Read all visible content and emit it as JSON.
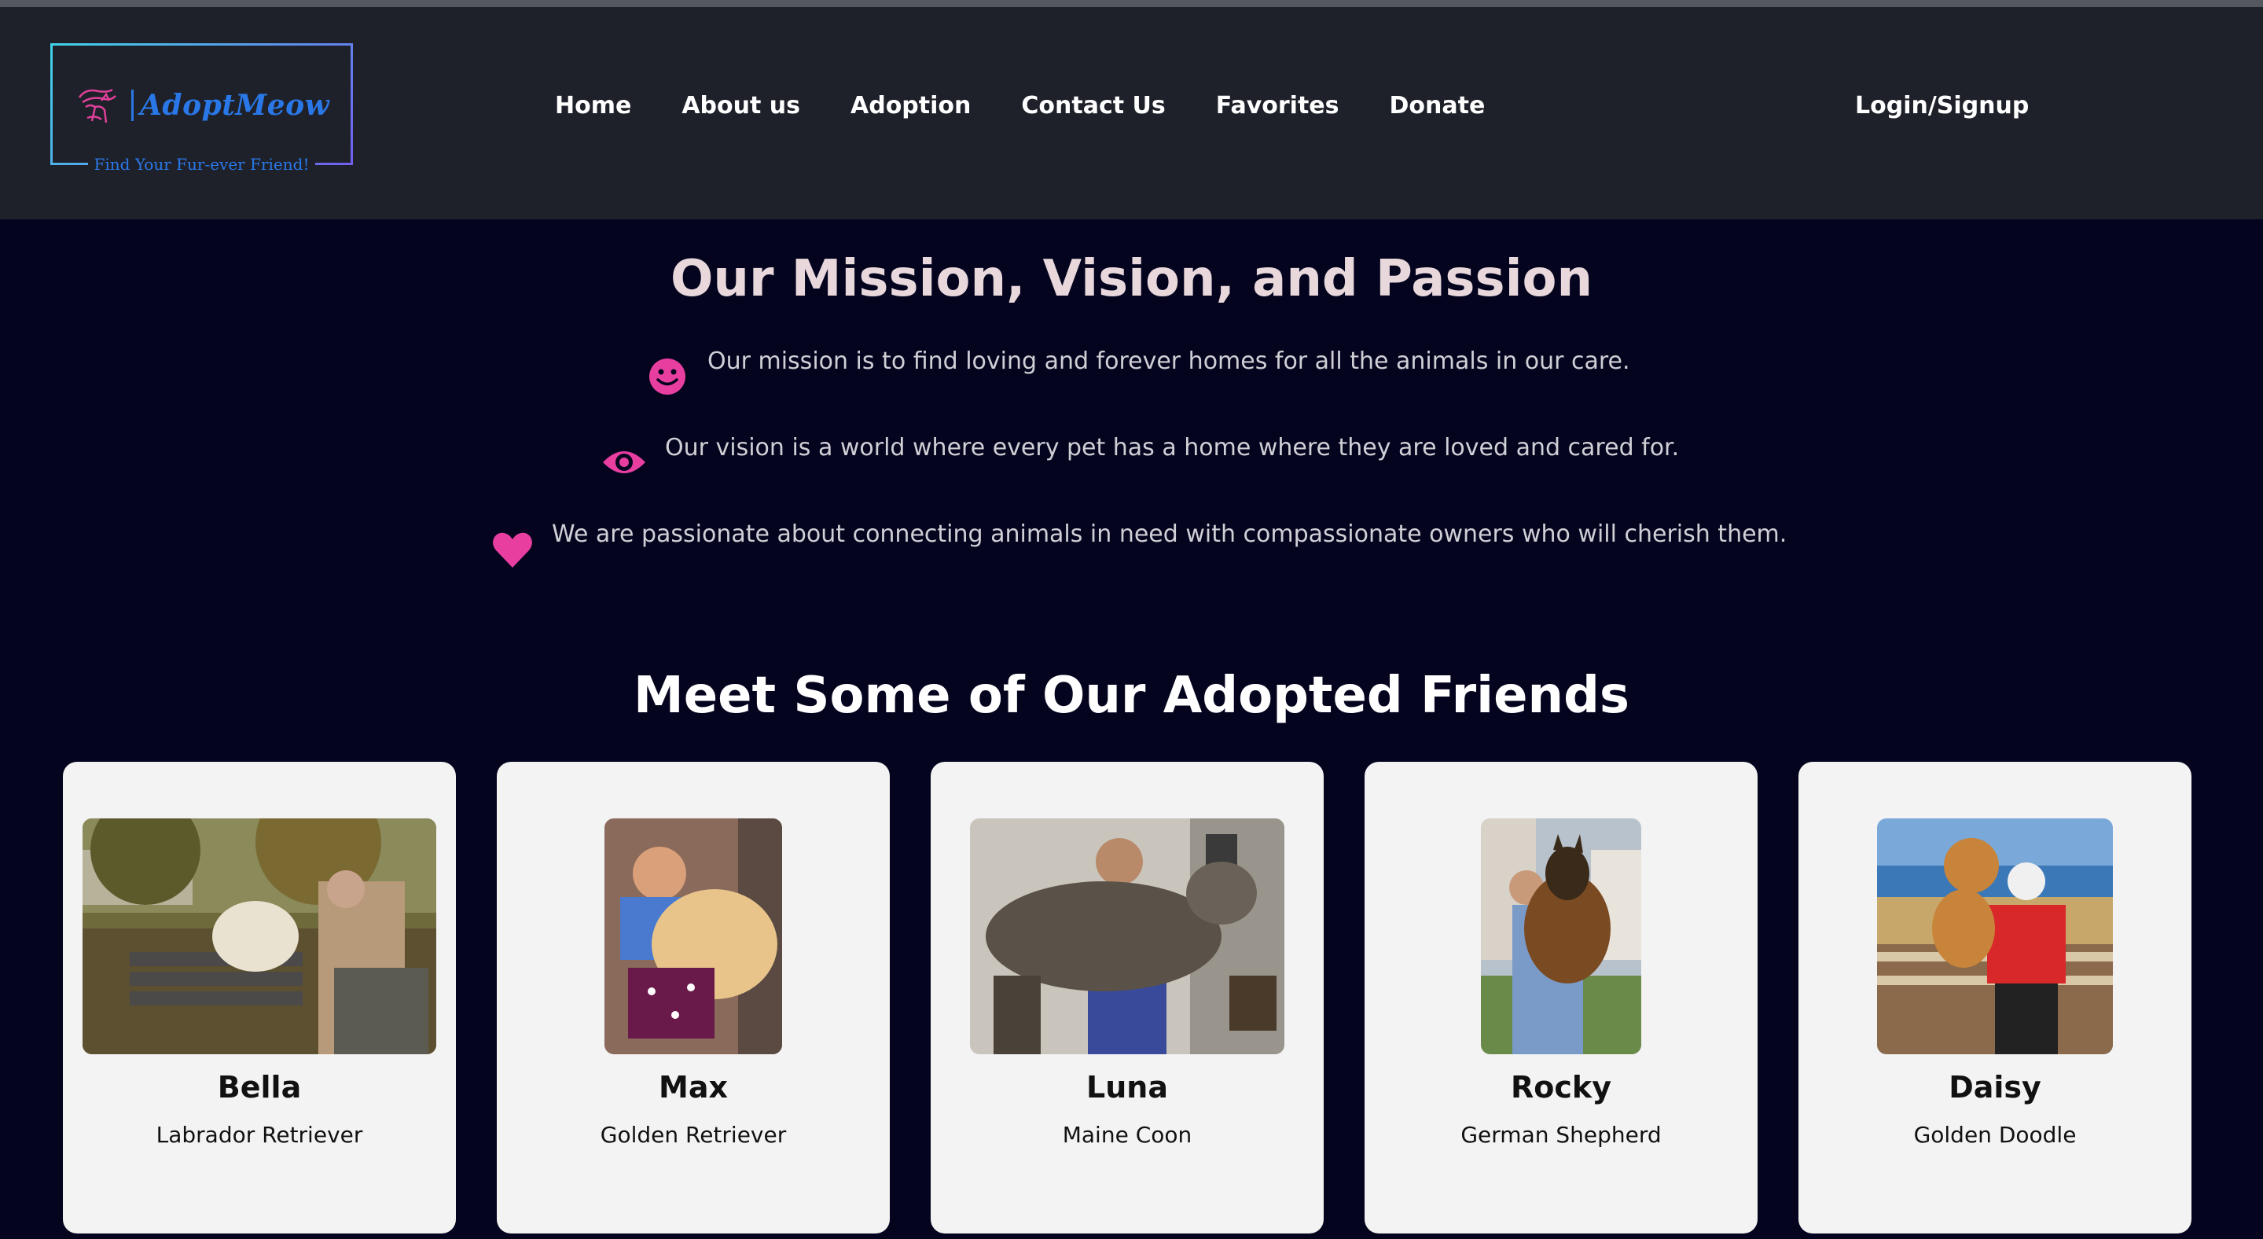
{
  "brand": {
    "name": "AdoptMeow",
    "tagline": "Find Your Fur-ever Friend!"
  },
  "nav": {
    "home": "Home",
    "about": "About us",
    "adoption": "Adoption",
    "contact": "Contact Us",
    "favorites": "Favorites",
    "donate": "Donate",
    "login": "Login/Signup"
  },
  "mission": {
    "title": "Our Mission, Vision, and Passion",
    "items": [
      {
        "icon": "smile-icon",
        "text": "Our mission is to find loving and forever homes for all the animals in our care."
      },
      {
        "icon": "eye-icon",
        "text": "Our vision is a world where every pet has a home where they are loved and cared for."
      },
      {
        "icon": "heart-icon",
        "text": "We are passionate about connecting animals in need with compassionate owners who will cherish them."
      }
    ]
  },
  "friends": {
    "title": "Meet Some of Our Adopted Friends",
    "pets": [
      {
        "name": "Bella",
        "breed": "Labrador Retriever"
      },
      {
        "name": "Max",
        "breed": "Golden Retriever"
      },
      {
        "name": "Luna",
        "breed": "Maine Coon"
      },
      {
        "name": "Rocky",
        "breed": "German Shepherd"
      },
      {
        "name": "Daisy",
        "breed": "Golden Doodle"
      }
    ]
  },
  "colors": {
    "background": "#04041f",
    "header": "#1e212a",
    "accent_pink": "#e83ea0",
    "brand_blue": "#2a78e8",
    "card": "#f3f3f3"
  }
}
